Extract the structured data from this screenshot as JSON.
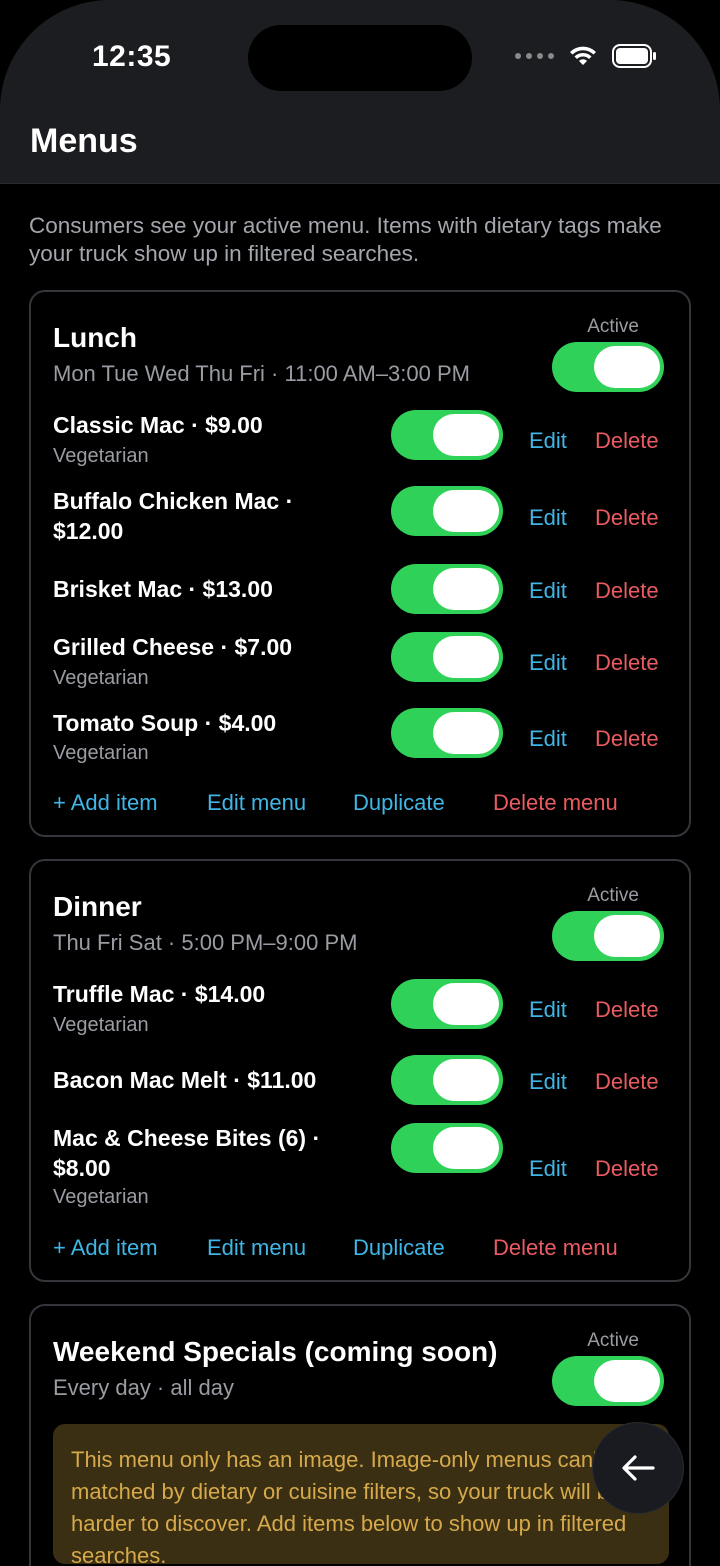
{
  "status": {
    "time": "12:35"
  },
  "page": {
    "title": "Menus",
    "intro": "Consumers see your active menu. Items with dietary tags make your truck show up in filtered searches."
  },
  "menus": [
    {
      "name": "Lunch",
      "schedule": "Mon Tue Wed Thu Fri · 11:00 AM–3:00 PM",
      "active_label": "Active",
      "items": [
        {
          "label": "Classic Mac · $9.00",
          "tag": "Vegetarian"
        },
        {
          "label": "Buffalo Chicken Mac · $12.00",
          "tag": ""
        },
        {
          "label": "Brisket Mac · $13.00",
          "tag": ""
        },
        {
          "label": "Grilled Cheese · $7.00",
          "tag": "Vegetarian"
        },
        {
          "label": "Tomato Soup · $4.00",
          "tag": "Vegetarian"
        }
      ]
    },
    {
      "name": "Dinner",
      "schedule": "Thu Fri Sat · 5:00 PM–9:00 PM",
      "active_label": "Active",
      "items": [
        {
          "label": "Truffle Mac · $14.00",
          "tag": "Vegetarian"
        },
        {
          "label": "Bacon Mac Melt · $11.00",
          "tag": ""
        },
        {
          "label": "Mac & Cheese Bites (6) · $8.00",
          "tag": "Vegetarian"
        }
      ]
    },
    {
      "name": "Weekend Specials (coming soon)",
      "schedule": "Every day · all day",
      "active_label": "Active",
      "warning": "This menu only has an image. Image-only menus can't be matched by dietary or cuisine filters, so your truck will be harder to discover. Add items below to show up in filtered searches."
    }
  ],
  "labels": {
    "edit": "Edit",
    "delete": "Delete",
    "add_item": "+ Add item",
    "edit_menu": "Edit menu",
    "duplicate": "Duplicate",
    "delete_menu": "Delete menu"
  },
  "colors": {
    "toggle_on": "#2fd158",
    "link_blue": "#3fb6e6",
    "danger_red": "#ea5b61",
    "warning_bg": "#3a2f13",
    "warning_text": "#d6a94a"
  }
}
